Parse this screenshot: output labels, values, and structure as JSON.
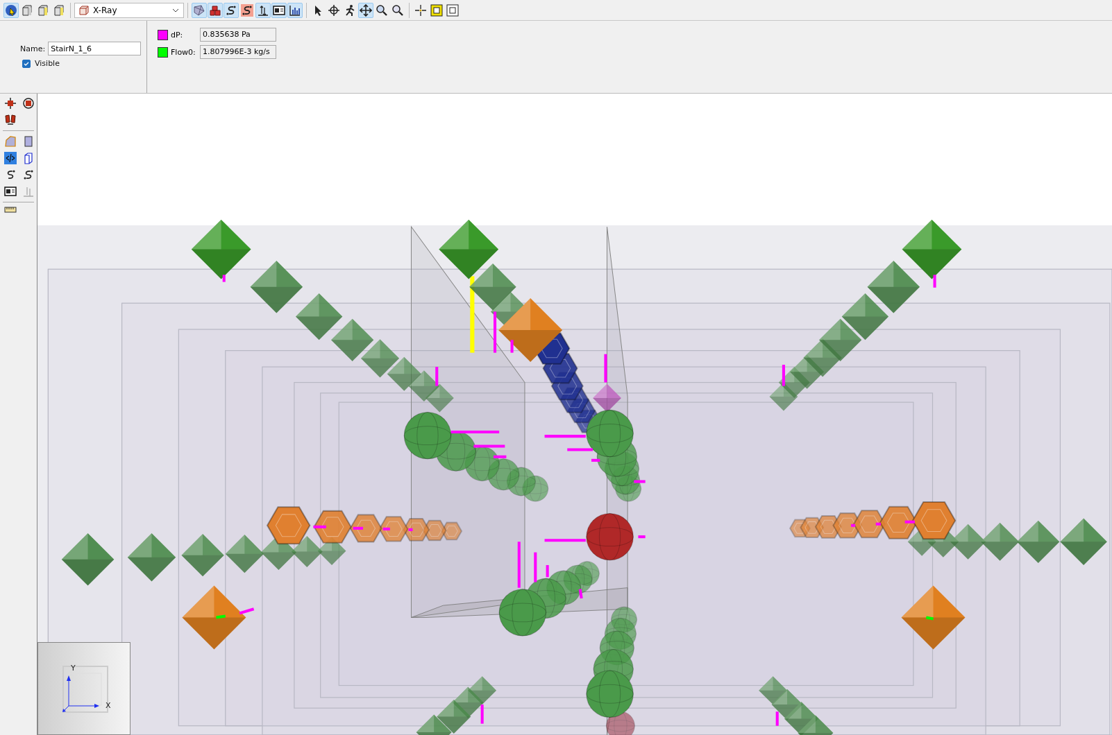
{
  "toolbar": {
    "buttons": [
      {
        "selected": true
      },
      {
        "selected": false
      },
      {
        "selected": false
      },
      {
        "selected": false
      },
      {
        "selected": true
      },
      {
        "selected": true
      },
      {
        "selected": true
      },
      {
        "selected": false
      },
      {
        "selected": true
      },
      {
        "selected": true
      },
      {
        "selected": true
      },
      {
        "selected": false
      },
      {
        "selected": false
      },
      {
        "selected": false
      },
      {
        "selected": true
      },
      {
        "selected": false
      },
      {
        "selected": false
      },
      {
        "selected": false
      },
      {
        "selected": false
      },
      {
        "selected": false
      }
    ],
    "view_mode": "X-Ray"
  },
  "properties": {
    "name_label": "Name:",
    "name_value": "StairN_1_6",
    "visible": {
      "label": "Visible",
      "checked": true
    }
  },
  "results": [
    {
      "color": "#ff00ff",
      "label": "dP:",
      "value": "0.835638 Pa"
    },
    {
      "color": "#00ff00",
      "label": "Flow0:",
      "value": "1.807996E-3 kg/s"
    }
  ],
  "axes": {
    "y_label": "Y",
    "x_label": "X"
  }
}
